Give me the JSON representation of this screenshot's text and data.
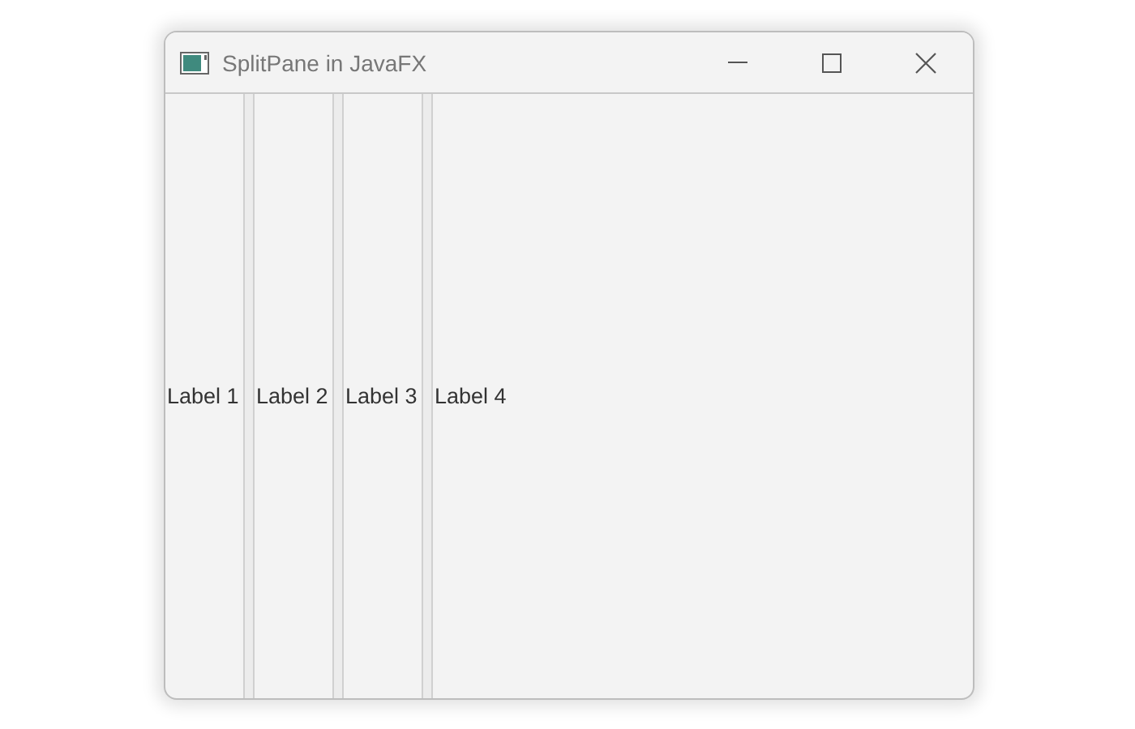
{
  "window": {
    "title": "SplitPane in JavaFX"
  },
  "panes": [
    {
      "label": "Label 1"
    },
    {
      "label": "Label 2"
    },
    {
      "label": "Label 3"
    },
    {
      "label": "Label 4"
    }
  ]
}
